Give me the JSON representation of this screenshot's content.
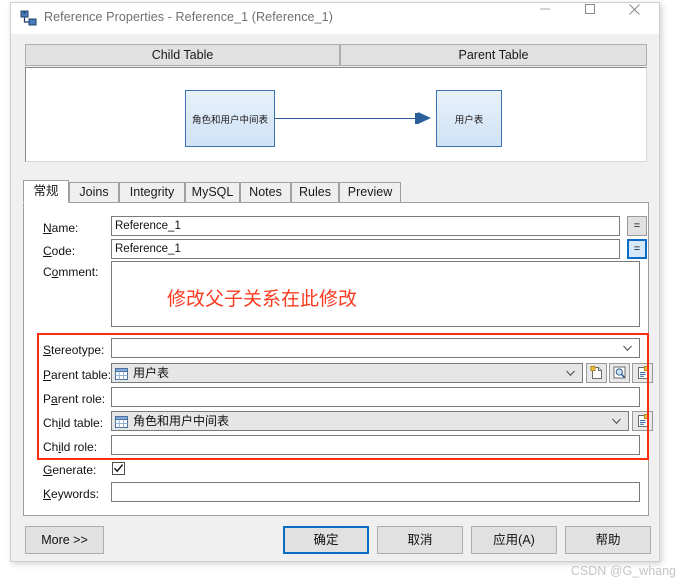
{
  "window": {
    "title": "Reference Properties - Reference_1 (Reference_1)",
    "icon": "reference-relationship-icon",
    "minimize": "minimize-icon",
    "maximize": "maximize-icon",
    "close": "close-icon"
  },
  "headers": {
    "child_table": "Child Table",
    "parent_table": "Parent Table"
  },
  "diagram": {
    "child_box_label": "角色和用户中间表",
    "parent_box_label": "用户表",
    "link_color": "#2a6099",
    "box_border_color": "#3b72b0"
  },
  "tabs": [
    {
      "label": "常规",
      "active": true
    },
    {
      "label": "Joins",
      "active": false
    },
    {
      "label": "Integrity",
      "active": false
    },
    {
      "label": "MySQL",
      "active": false
    },
    {
      "label": "Notes",
      "active": false
    },
    {
      "label": "Rules",
      "active": false
    },
    {
      "label": "Preview",
      "active": false
    }
  ],
  "form": {
    "name_label": "Name:",
    "name_value": "Reference_1",
    "name_eq_button": "=",
    "code_label": "Code:",
    "code_value": "Reference_1",
    "code_eq_button": "=",
    "comment_label": "Comment:",
    "comment_value": "",
    "annotation": "修改父子关系在此修改",
    "annotation_color": "#fb3b1f",
    "stereotype_label": "Stereotype:",
    "stereotype_value": "",
    "parent_table_label": "Parent table:",
    "parent_table_value": "用户表",
    "parent_role_label": "Parent role:",
    "parent_role_value": "",
    "child_table_label": "Child table:",
    "child_table_value": "角色和用户中间表",
    "child_role_label": "Child role:",
    "child_role_value": "",
    "generate_label": "Generate:",
    "generate_checked": true,
    "keywords_label": "Keywords:",
    "keywords_value": "",
    "highlight_color": "#fe2d0b"
  },
  "buttons": {
    "more": "More >>",
    "ok": "确定",
    "cancel": "取消",
    "apply": "应用(A)",
    "help": "帮助"
  },
  "watermark": "CSDN @G_whang"
}
